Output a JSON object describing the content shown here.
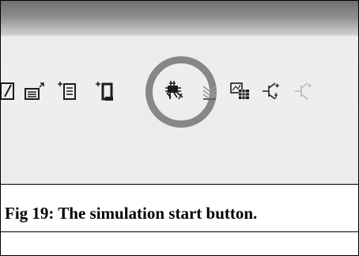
{
  "toolbar": {
    "icons": [
      "edit-icon",
      "window-up-icon",
      "add-document-icon",
      "add-device-icon",
      "simulation-start-icon",
      "tune-icon",
      "table-icon",
      "transistor-icon",
      "transistor-faded-icon"
    ],
    "highlight_color": "#878787"
  },
  "caption": {
    "text": "Fig 19: The simulation start button."
  }
}
